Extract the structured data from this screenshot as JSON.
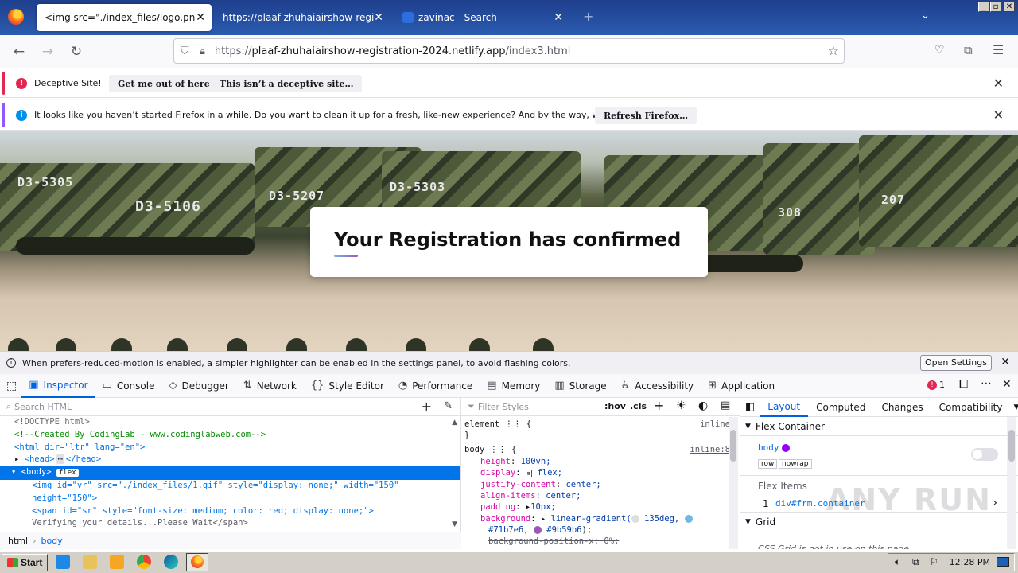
{
  "browser": {
    "tabs": [
      {
        "title": "<img src=\"./index_files/logo.png\" alt=\""
      },
      {
        "title": "https://plaaf-zhuhaiairshow-registration"
      },
      {
        "title": "zavinac - Search"
      }
    ],
    "url": {
      "scheme": "https://",
      "host": "plaaf-zhuhaiairshow-registration-2024.netlify.app",
      "path": "/index3.html"
    }
  },
  "notifications": {
    "deceptive": {
      "text": "Deceptive Site!",
      "btn1": "Get me out of here!",
      "btn2": "This isn’t a deceptive site…"
    },
    "refresh": {
      "text": "It looks like you haven’t started Firefox in a while. Do you want to clean it up for a fresh, like-new experience? And by the way, welcome back!",
      "btn": "Refresh Firefox…"
    }
  },
  "page": {
    "title": "Your Registration has confirmed",
    "vehicle_numbers": [
      "D3-5305",
      "D3-5207",
      "D3-5303",
      "D3-5106",
      "308",
      "207"
    ]
  },
  "devtools": {
    "motion_notice": "When prefers-reduced-motion is enabled, a simpler highlighter can be enabled in the settings panel, to avoid flashing colors.",
    "open_settings": "Open Settings",
    "tabs": [
      "Inspector",
      "Console",
      "Debugger",
      "Network",
      "Style Editor",
      "Performance",
      "Memory",
      "Storage",
      "Accessibility",
      "Application"
    ],
    "error_count": "1",
    "search_placeholder": "Search HTML",
    "filter_placeholder": "Filter Styles",
    "hov": ":hov",
    "cls": ".cls",
    "html": {
      "doctype": "<!DOCTYPE html>",
      "comment": "<!--Created By CodingLab - www.codinglabweb.com-->",
      "html_open": "<html dir=\"ltr\" lang=\"en\">",
      "head": "<head>",
      "head_close": "</head>",
      "body": "<body>",
      "flex_badge": "flex",
      "img_line1": "<img id=\"vr\" src=\"./index_files/1.gif\" style=\"display: none;\" width=\"150\"",
      "img_line2": "height=\"150\">",
      "span_line": "<span id=\"sr\" style=\"font-size: medium; color: red; display: none;\">",
      "span_text": "Verifying your details...Please Wait</span>"
    },
    "breadcrumbs": [
      "html",
      "body"
    ],
    "rules": {
      "element": "element",
      "element_source": "inline",
      "body_selector": "body",
      "body_source": "inline:8",
      "declarations": [
        {
          "prop": "height",
          "value": "100vh;"
        },
        {
          "prop": "display",
          "value": "flex;"
        },
        {
          "prop": "justify-content",
          "value": "center;"
        },
        {
          "prop": "align-items",
          "value": "center;"
        },
        {
          "prop": "padding",
          "value": "10px;"
        },
        {
          "prop": "background",
          "value": "linear-gradient(135deg, #71b7e6, #9b59b6);"
        },
        {
          "prop": "background-position-x",
          "value": "0%;"
        }
      ],
      "gradient_color_1": "#71b7e6",
      "gradient_color_2": "#9b59b6"
    },
    "layout": {
      "tabs": [
        "Layout",
        "Computed",
        "Changes",
        "Compatibility"
      ],
      "flex_container": "Flex Container",
      "body": "body",
      "row": "row",
      "nowrap": "nowrap",
      "flex_items": "Flex Items",
      "flex_item": "div#frm.container",
      "flex_item_index": "1",
      "grid": "Grid",
      "grid_note": "CSS Grid is not in use on this page"
    }
  },
  "watermark": "ANY RUN",
  "taskbar": {
    "start": "Start",
    "time": "12:28 PM"
  }
}
